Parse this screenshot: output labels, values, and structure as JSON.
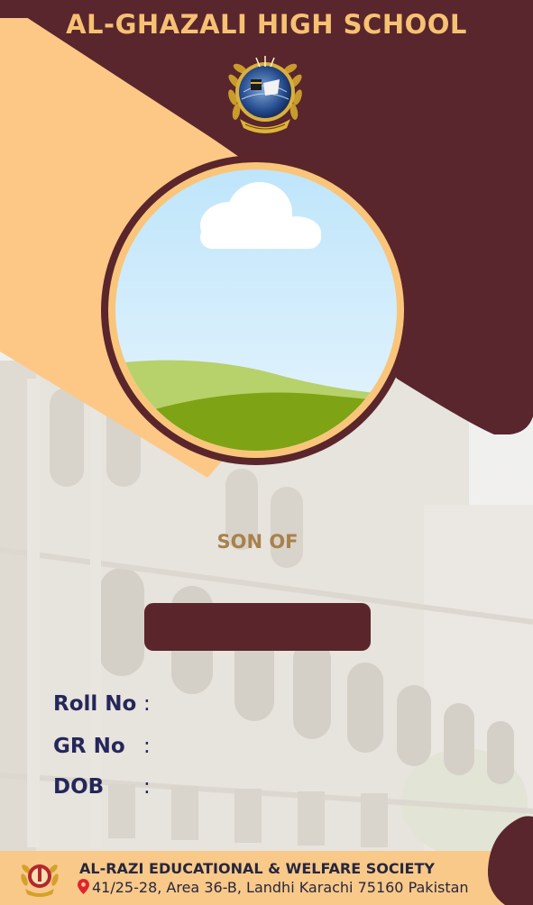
{
  "school": {
    "name": "AL-GHAZALI HIGH SCHOOL"
  },
  "student": {
    "relation_label": "SON OF"
  },
  "fields": [
    {
      "label": "Roll No",
      "separator": ":"
    },
    {
      "label": "GR No",
      "separator": ":"
    },
    {
      "label": "DOB",
      "separator": ":"
    }
  ],
  "footer": {
    "society": "AL-RAZI EDUCATIONAL & WELFARE SOCIETY",
    "address": "41/25-28, Area 36-B, Landhi Karachi 75160 Pakistan"
  },
  "colors": {
    "maroon": "#5a262b",
    "peach": "#f9c57b",
    "title_gold": "#f7c173",
    "label_navy": "#25275a",
    "son_of_gold": "#a8814b"
  },
  "icons": {
    "school_logo": "school-crest-icon",
    "photo_placeholder": "landscape-placeholder-icon",
    "location": "map-pin-icon",
    "society_logo": "society-emblem-icon"
  }
}
